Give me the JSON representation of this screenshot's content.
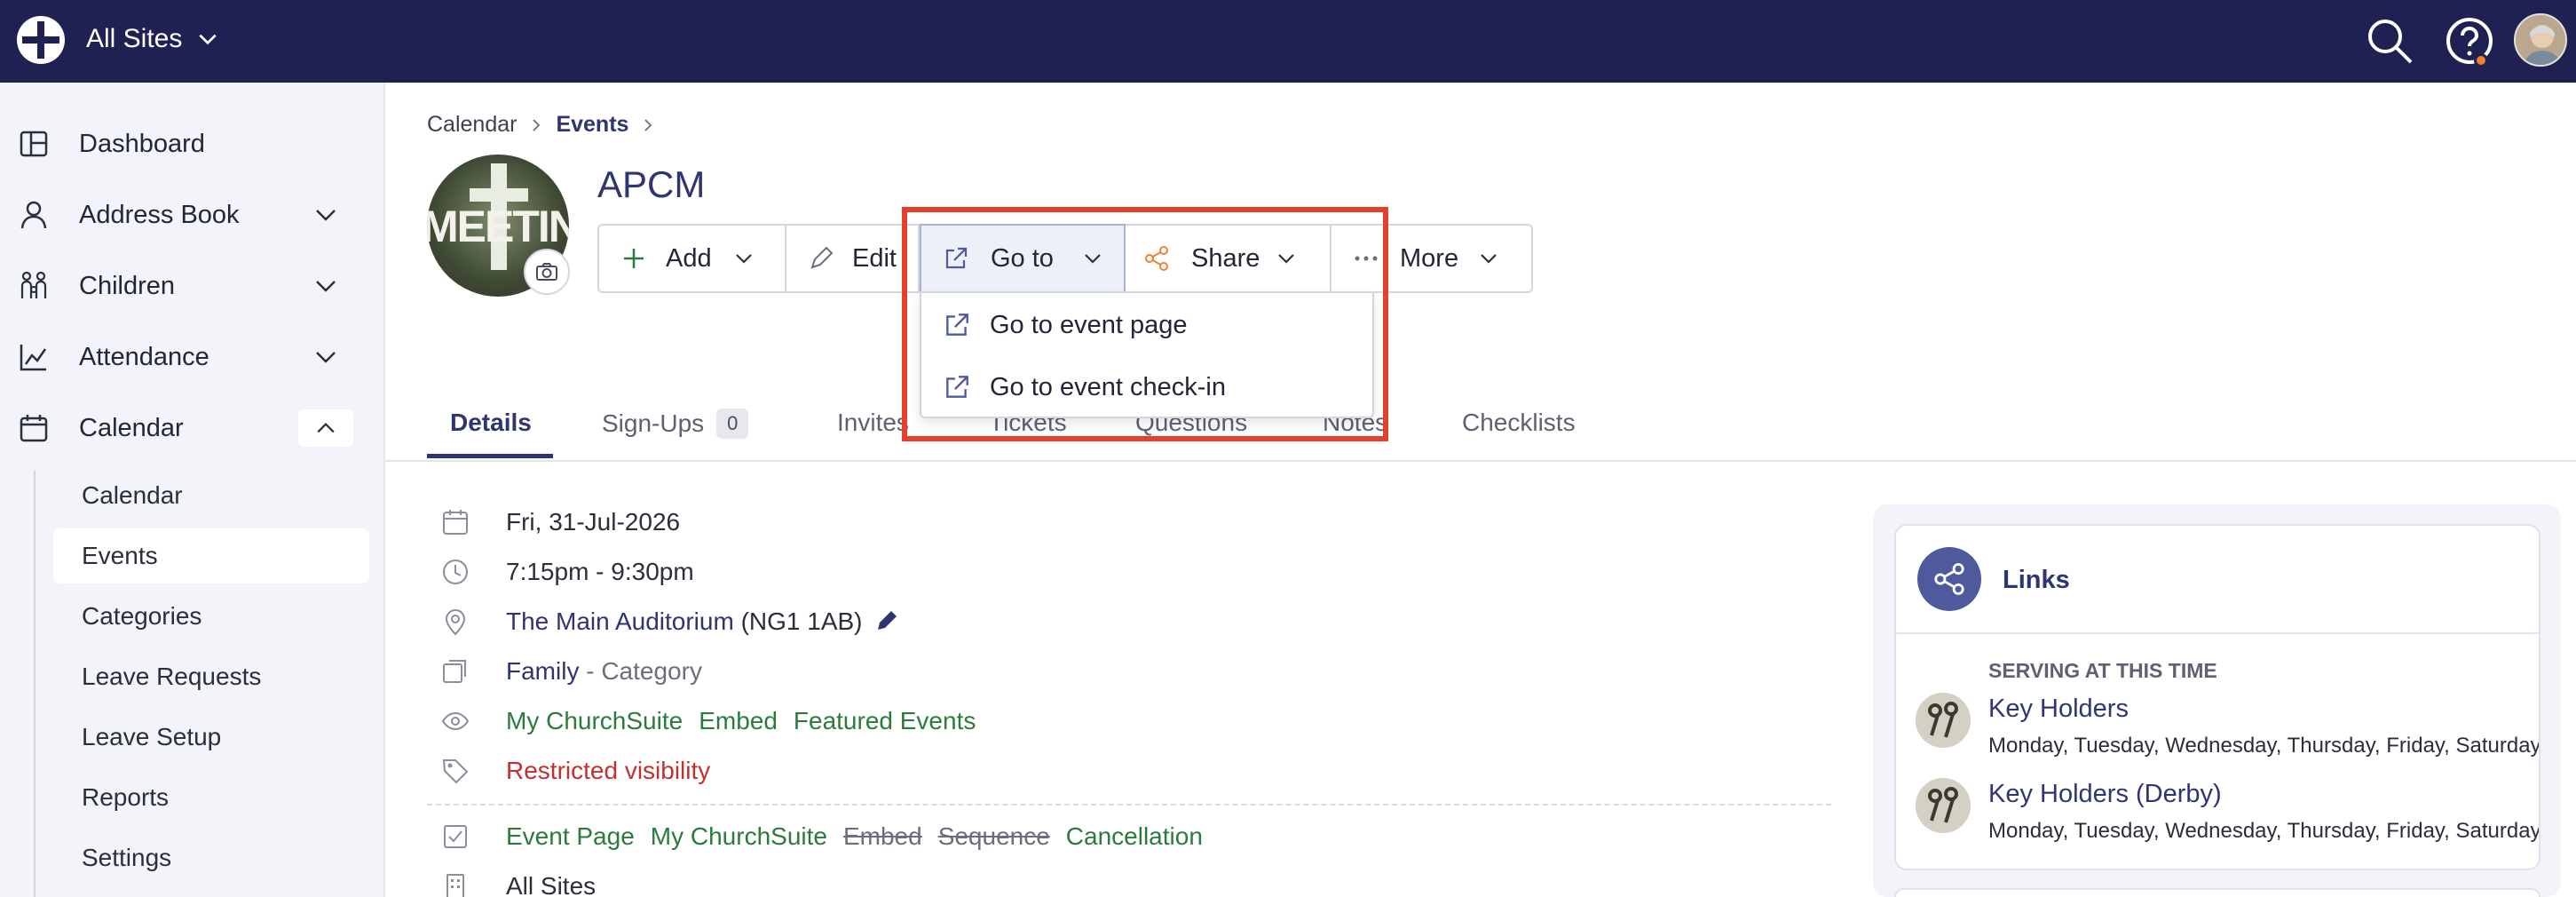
{
  "topbar": {
    "site_label": "All Sites"
  },
  "sidebar": {
    "items": [
      {
        "label": "Dashboard"
      },
      {
        "label": "Address Book"
      },
      {
        "label": "Children"
      },
      {
        "label": "Attendance"
      },
      {
        "label": "Calendar"
      }
    ],
    "calendar_sub": [
      "Calendar",
      "Events",
      "Categories",
      "Leave Requests",
      "Leave Setup",
      "Reports",
      "Settings"
    ]
  },
  "breadcrumb": {
    "first": "Calendar",
    "second": "Events"
  },
  "event": {
    "title": "APCM"
  },
  "toolbar": {
    "add": "Add",
    "edit": "Edit",
    "goto": "Go to",
    "share": "Share",
    "more": "More"
  },
  "goto_menu": {
    "items": [
      "Go to event page",
      "Go to event check-in"
    ]
  },
  "tabs": {
    "details": "Details",
    "signups": "Sign-Ups",
    "signups_count": "0",
    "invites": "Invites",
    "tickets": "Tickets",
    "questions": "Questions",
    "notes": "Notes",
    "checklists": "Checklists"
  },
  "details": {
    "date": "Fri, 31-Jul-2026",
    "time": "7:15pm - 9:30pm",
    "location_name": "The Main Auditorium",
    "location_postcode": "(NG1 1AB)",
    "category_name": "Family",
    "category_suffix": "- Category",
    "visibility_links": [
      "My ChurchSuite",
      "Embed",
      "Featured Events"
    ],
    "restricted": "Restricted visibility",
    "features": {
      "event_page": "Event Page",
      "my_churchsuite": "My ChurchSuite",
      "embed": "Embed",
      "sequence": "Sequence",
      "cancellation": "Cancellation"
    },
    "site": "All Sites"
  },
  "links_panel": {
    "title": "Links",
    "serving_label": "SERVING AT THIS TIME",
    "teams": [
      {
        "name": "Key Holders",
        "days": "Monday, Tuesday, Wednesday, Thursday, Friday, Saturday"
      },
      {
        "name": "Key Holders (Derby)",
        "days": "Monday, Tuesday, Wednesday, Thursday, Friday, Saturday"
      }
    ]
  },
  "colors": {
    "topbar": "#1e2152",
    "accent": "#2e3570",
    "green": "#2c7b3d",
    "red": "#c43030",
    "highlight": "#e3412e",
    "orange": "#f0812f"
  }
}
